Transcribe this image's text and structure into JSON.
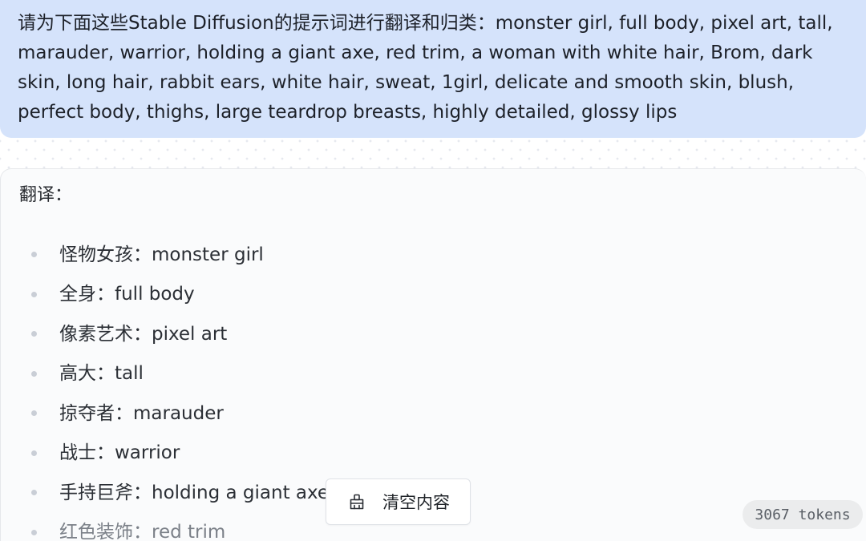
{
  "user_message": {
    "text": "请为下面这些Stable Diffusion的提示词进行翻译和归类：monster girl, full body, pixel art, tall, marauder, warrior, holding a giant axe, red trim, a woman with white hair, Brom, dark skin, long hair, rabbit ears, white hair, sweat, 1girl, delicate and smooth skin, blush, perfect body, thighs, large teardrop breasts, highly detailed, glossy lips"
  },
  "reply": {
    "heading": "翻译：",
    "items": [
      {
        "label": "怪物女孩：monster girl"
      },
      {
        "label": "全身：full body"
      },
      {
        "label": "像素艺术：pixel art"
      },
      {
        "label": "高大：tall"
      },
      {
        "label": "掠夺者：marauder"
      },
      {
        "label": "战士：warrior"
      },
      {
        "label": "手持巨斧：holding a giant axe"
      },
      {
        "label": "红色装饰：red trim"
      }
    ]
  },
  "toolbar": {
    "clear_label": "清空内容",
    "clear_icon": "broom-icon"
  },
  "status": {
    "tokens_label": "3067 tokens"
  },
  "colors": {
    "user_bubble_bg": "#d5e3fb",
    "card_bg": "#fafbfc",
    "badge_bg": "#ebeced"
  }
}
